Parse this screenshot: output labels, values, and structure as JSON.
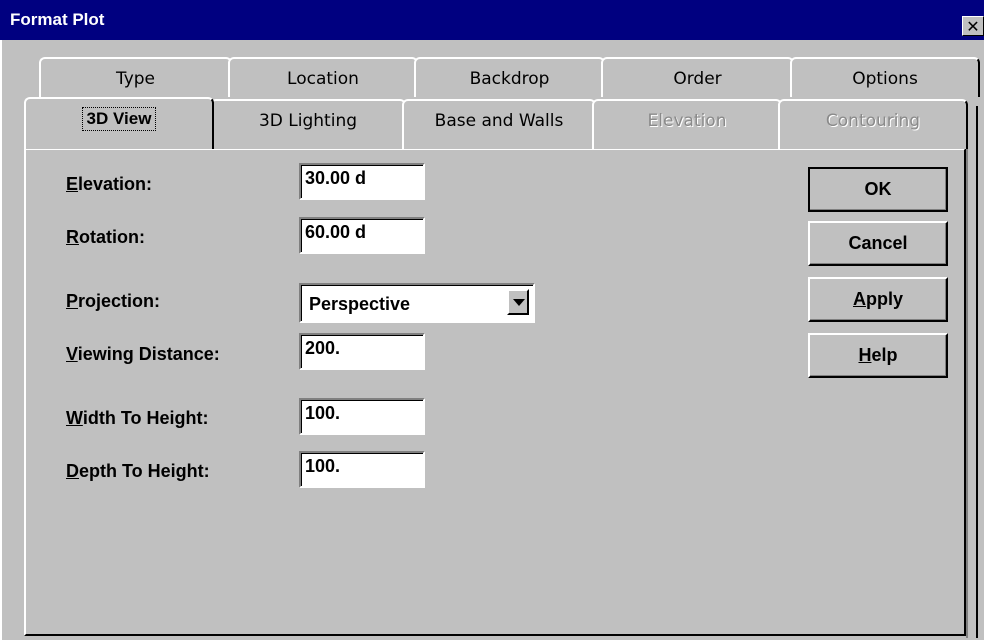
{
  "window": {
    "title": "Format Plot",
    "close_glyph": "✕"
  },
  "tabs_back": [
    {
      "label": "Type",
      "enabled": true
    },
    {
      "label": "Location",
      "enabled": true
    },
    {
      "label": "Backdrop",
      "enabled": true
    },
    {
      "label": "Order",
      "enabled": true
    },
    {
      "label": "Options",
      "enabled": true
    }
  ],
  "tabs_front": [
    {
      "label": "3D View",
      "enabled": true,
      "active": true
    },
    {
      "label": "3D Lighting",
      "enabled": true
    },
    {
      "label": "Base and Walls",
      "enabled": true
    },
    {
      "label": "Elevation",
      "enabled": false
    },
    {
      "label": "Contouring",
      "enabled": false
    }
  ],
  "fields": {
    "elevation": {
      "label_mnemonic": "E",
      "label_rest": "levation:",
      "value": "30.00 d"
    },
    "rotation": {
      "label_mnemonic": "R",
      "label_rest": "otation:",
      "value": "60.00 d"
    },
    "projection": {
      "label_mnemonic": "P",
      "label_rest": "rojection:",
      "value": "Perspective"
    },
    "viewing_distance": {
      "label_mnemonic": "V",
      "label_rest": "iewing Distance:",
      "value": "200."
    },
    "width_to_height": {
      "label_mnemonic": "W",
      "label_rest": "idth To Height:",
      "value": "100."
    },
    "depth_to_height": {
      "label_mnemonic": "D",
      "label_rest": "epth To Height:",
      "value": "100."
    }
  },
  "buttons": {
    "ok": "OK",
    "cancel": "Cancel",
    "apply_mnemonic": "A",
    "apply_rest": "pply",
    "help_mnemonic": "H",
    "help_rest": "elp"
  },
  "colors": {
    "titlebar": "#000080",
    "face": "#c0c0c0",
    "disabled_text": "#8a8a8a"
  }
}
